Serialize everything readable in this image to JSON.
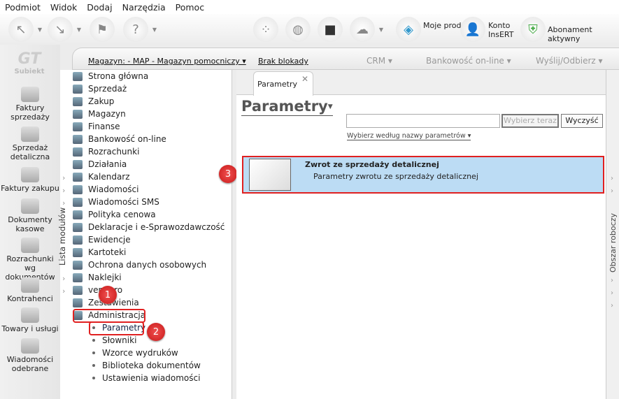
{
  "menu": [
    "Podmiot",
    "Widok",
    "Dodaj",
    "Narzędzia",
    "Pomoc"
  ],
  "toolbar": {
    "moje_produkty": "Moje produkty",
    "konto": "Konto InsERT",
    "abonament": "Abonament aktywny"
  },
  "logo": "Subiekt",
  "leftbar": [
    "Faktury sprzedaży",
    "Sprzedaż detaliczna",
    "Faktury zakupu",
    "Dokumenty kasowe",
    "Rozrachunki wg dokumentów",
    "Kontrahenci",
    "Towary i usługi",
    "Wiadomości odebrane"
  ],
  "header": {
    "magazyn": "Magazyn: - MAP - Magazyn pomocniczy ▾",
    "blokada": "Brak blokady",
    "crm": "CRM ▾",
    "bank": "Bankowość on-line ▾",
    "wyslij": "Wyślij/Odbierz ▾"
  },
  "modules_label": "Lista modułów",
  "modules": [
    "Strona główna",
    "Sprzedaż",
    "Zakup",
    "Magazyn",
    "Finanse",
    "Bankowość on-line",
    "Rozrachunki",
    "Działania",
    "Kalendarz",
    "Wiadomości",
    "Wiadomości SMS",
    "Polityka cenowa",
    "Deklaracje i e-Sprawozdawczość",
    "Ewidencje",
    "Kartoteki",
    "Ochrona danych osobowych",
    "Naklejki",
    "vendero",
    "Zestawienia",
    "Administracja"
  ],
  "admin_sub": [
    "Parametry",
    "Słowniki",
    "Wzorce wydruków",
    "Biblioteka dokumentów",
    "Ustawienia wiadomości"
  ],
  "badges": [
    "1",
    "2",
    "3"
  ],
  "tab": {
    "label": "Parametry",
    "close": "✕"
  },
  "page_title": "Parametry",
  "search": {
    "value": "",
    "select_btn": "Wybierz teraz",
    "clear_btn": "Wyczyść",
    "filter": "Wybierz według nazwy parametrów ▾"
  },
  "card": {
    "title": "Zwrot ze sprzedaży detalicznej",
    "desc": "Parametry zwrotu ze sprzedaży detalicznej"
  },
  "right_label": "Obszar roboczy",
  "colors": {
    "highlight": "#e02020",
    "selected": "#bcdcf4"
  }
}
